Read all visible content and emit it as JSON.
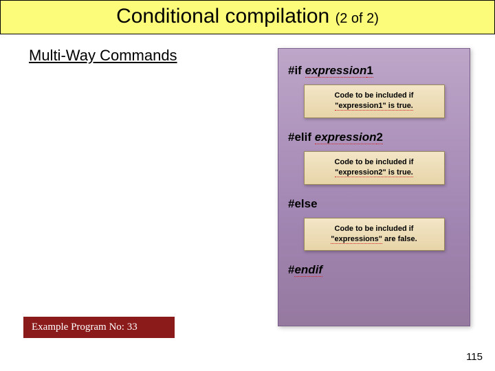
{
  "title": {
    "main": "Conditional compilation ",
    "sub": "(2 of 2)"
  },
  "subtitle": "Multi-Way Commands",
  "panel": {
    "if": {
      "kw": "#if ",
      "expr": "expression",
      "num": "1"
    },
    "box1": {
      "l1": "Code to be included if",
      "l2": "\"expression1\" is true."
    },
    "elif": {
      "kw": "#elif ",
      "expr": "expression",
      "num": "2"
    },
    "box2": {
      "l1": "Code to be included if",
      "l2": "\"expression2\" is true."
    },
    "else": {
      "kw": "#else"
    },
    "box3": {
      "l1": "Code to be included if",
      "l2a": "\"expressions\"",
      "l2b": " are false."
    },
    "endif": {
      "kw": "#",
      "expr": "endif"
    }
  },
  "example": "Example Program No: 33",
  "page": "115"
}
